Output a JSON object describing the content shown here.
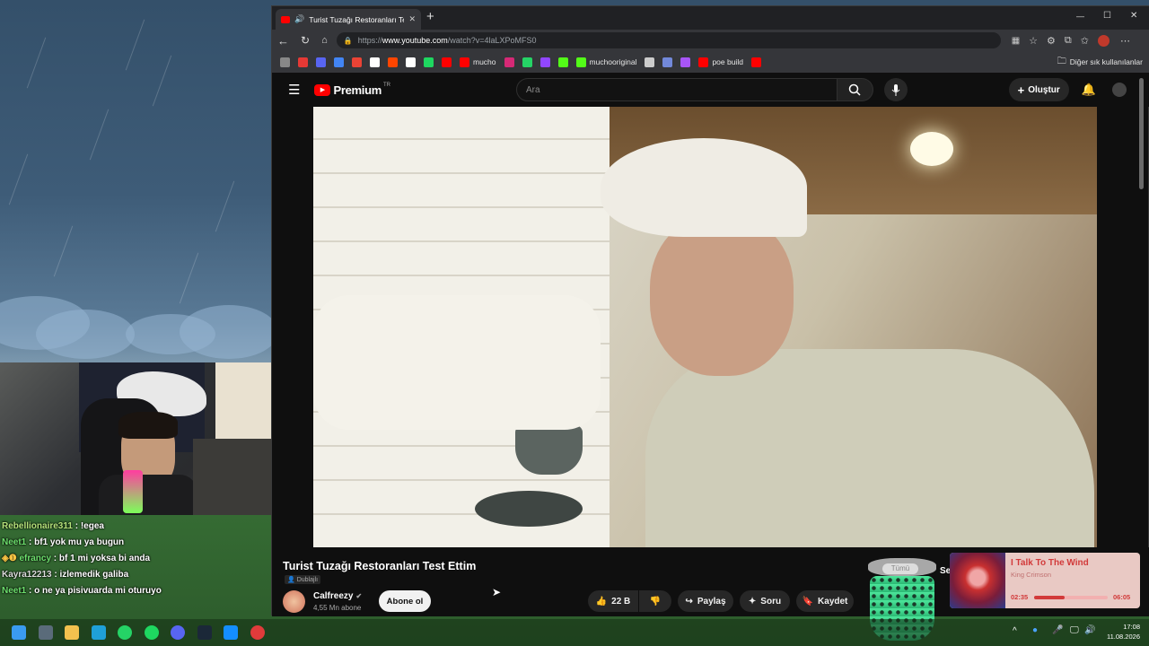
{
  "browser": {
    "tab_title": "Turist Tuzağı Restoranları Test",
    "tab_close": "✕",
    "new_tab": "+",
    "url_prefix": "https://",
    "url_domain": "www.youtube.com",
    "url_path": "/watch?v=4laLXPoMFS0",
    "window_controls": [
      "—",
      "☐",
      "✕"
    ]
  },
  "bookmarks": {
    "items": [
      {
        "label": "",
        "color": "#888888"
      },
      {
        "label": "",
        "color": "#e53935"
      },
      {
        "label": "",
        "color": "#5865f2"
      },
      {
        "label": "",
        "color": "#4285f4"
      },
      {
        "label": "",
        "color": "#ea4335"
      },
      {
        "label": "",
        "color": "#ffffff"
      },
      {
        "label": "",
        "color": "#ff4500"
      },
      {
        "label": "",
        "color": "#ffffff"
      },
      {
        "label": "",
        "color": "#1ed760"
      },
      {
        "label": "",
        "color": "#ff0000"
      },
      {
        "label": "mucho",
        "color": "#ff0000"
      },
      {
        "label": "",
        "color": "#d62976"
      },
      {
        "label": "",
        "color": "#25d366"
      },
      {
        "label": "",
        "color": "#9146ff"
      },
      {
        "label": "",
        "color": "#53fc18"
      },
      {
        "label": "muchooriginal",
        "color": "#53fc18"
      },
      {
        "label": "",
        "color": "#cccccc"
      },
      {
        "label": "",
        "color": "#7289da"
      },
      {
        "label": "",
        "color": "#a855f7"
      },
      {
        "label": "poe build",
        "color": "#ff0000"
      },
      {
        "label": "",
        "color": "#ff0000"
      }
    ],
    "other": "Diğer sık kullanılanlar"
  },
  "youtube": {
    "logo": "Premium",
    "region": "TR",
    "search_placeholder": "Ara",
    "create_label": "Oluştur"
  },
  "video": {
    "title": "Turist Tuzağı Restoranları Test Ettim",
    "dubbed": "Dublajlı",
    "channel": "Calfreezy",
    "subs": "4,55 Mn abone",
    "subscribe": "Abone ol",
    "likes": "22 B",
    "share": "Paylaş",
    "ask": "Soru",
    "save": "Kaydet",
    "overlay_text": "Se"
  },
  "cup_widget": {
    "label": "Tümü"
  },
  "music": {
    "title": "I Talk To The Wind",
    "artist": "King Crimson",
    "elapsed": "02:35",
    "duration": "06:05",
    "progress": 0.42
  },
  "chat": [
    {
      "user": "Rebellionaire311",
      "msg": ": !egea",
      "color": "#b5e27a",
      "badge": ""
    },
    {
      "user": "Neet1",
      "msg": ": bf1 yok mu ya bugun",
      "color": "#6de06d",
      "badge": ""
    },
    {
      "user": "efrancy",
      "msg": ": bf 1 mi yoksa bi anda",
      "color": "#6de06d",
      "badge": "◈❶"
    },
    {
      "user": "Kayra12213",
      "msg": ": izlemedik galiba",
      "color": "#dddddd",
      "badge": ""
    },
    {
      "user": "Neet1",
      "msg": ": o ne ya pisivuarda mi oturuyo",
      "color": "#6de06d",
      "badge": ""
    }
  ],
  "taskbar": {
    "time": "17:08",
    "date": "11.08.2026",
    "icons": [
      {
        "name": "windows",
        "color": "#3a9bf0"
      },
      {
        "name": "calculator",
        "color": "#5a6b7a"
      },
      {
        "name": "file-explorer",
        "color": "#f2c14e"
      },
      {
        "name": "edge",
        "color": "#1fa0d8"
      },
      {
        "name": "whatsapp",
        "color": "#25d366"
      },
      {
        "name": "spotify",
        "color": "#1ed760"
      },
      {
        "name": "discord",
        "color": "#5865f2"
      },
      {
        "name": "steam",
        "color": "#1b2838"
      },
      {
        "name": "battlenet",
        "color": "#148eff"
      },
      {
        "name": "recording",
        "color": "#e03b3b"
      }
    ]
  }
}
